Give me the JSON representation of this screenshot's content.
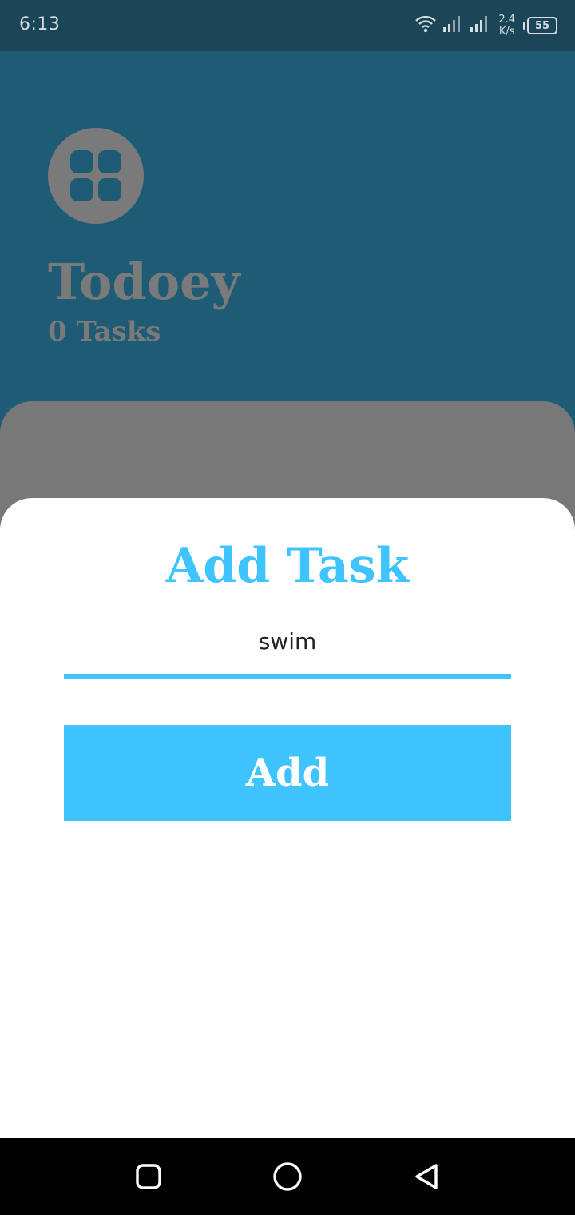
{
  "status_bar": {
    "time": "6:13",
    "net_speed_value": "2.4",
    "net_speed_unit": "K/s",
    "battery_level": "55",
    "icons": [
      "wifi-icon",
      "signal-icon",
      "signal-icon",
      "battery-icon"
    ]
  },
  "app": {
    "title": "Todoey",
    "task_count": "0 Tasks",
    "icon": "menu-grid-icon"
  },
  "sheet": {
    "title": "Add Task",
    "input_value": "swim",
    "button_label": "Add"
  },
  "nav_bar": {
    "icons": [
      "recents-icon",
      "home-icon",
      "back-icon"
    ]
  },
  "colors": {
    "accent": "#40c4ff",
    "header_bg": "#1e5b75",
    "status_bg": "#1b4658",
    "dim_gray": "#7a7a7a"
  }
}
